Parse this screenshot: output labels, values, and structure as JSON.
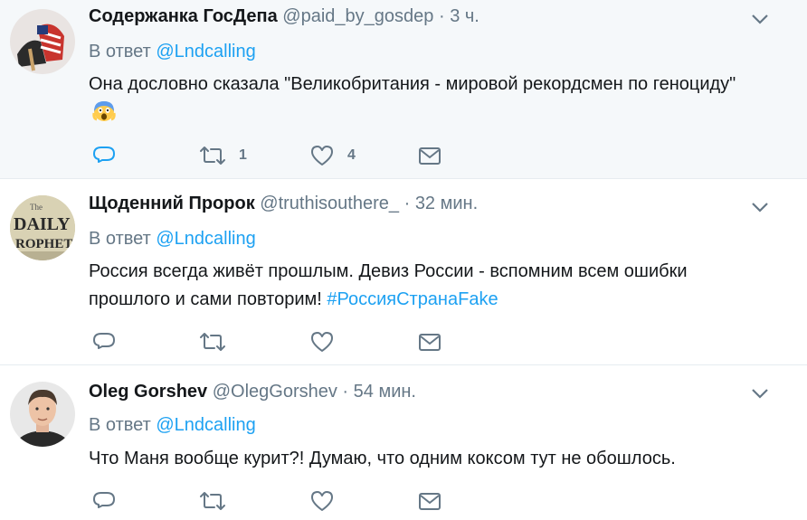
{
  "tweets": [
    {
      "name": "Содержанка ГосДепа",
      "handle": "@paid_by_gosdep",
      "dot": "·",
      "time": "3 ч.",
      "reply_prefix": "В ответ",
      "reply_to": "@Lndcalling",
      "text": "Она дословно сказала \"Великобритания - мировой рекордсмен по геноциду\"",
      "emoji": "scream-emoji",
      "retweets": "1",
      "likes": "4"
    },
    {
      "name": "Щоденний Пророк",
      "handle": "@truthisouthere_",
      "dot": "·",
      "time": "32 мин.",
      "reply_prefix": "В ответ",
      "reply_to": "@Lndcalling",
      "text": "Россия всегда живёт прошлым. Девиз России - вспомним всем ошибки прошлого и сами повторим!",
      "hashtag": "#РоссияСтранаFake",
      "avatar_text_1": "DAILY",
      "avatar_text_2": "ROPHET",
      "avatar_text_small": "The"
    },
    {
      "name": "Oleg Gorshev",
      "handle": "@OlegGorshev",
      "dot": "·",
      "time": "54 мин.",
      "reply_prefix": "В ответ",
      "reply_to": "@Lndcalling",
      "text": "Что Маня вообще курит?! Думаю, что одним коксом тут не обошлось."
    }
  ],
  "icons": {
    "reply": "reply-icon",
    "retweet": "retweet-icon",
    "like": "heart-icon",
    "message": "envelope-icon",
    "caret": "chevron-down-icon"
  },
  "colors": {
    "accent": "#1da1f2",
    "muted": "#657786",
    "text": "#14171a",
    "highlight_bg": "#f5f8fa"
  }
}
